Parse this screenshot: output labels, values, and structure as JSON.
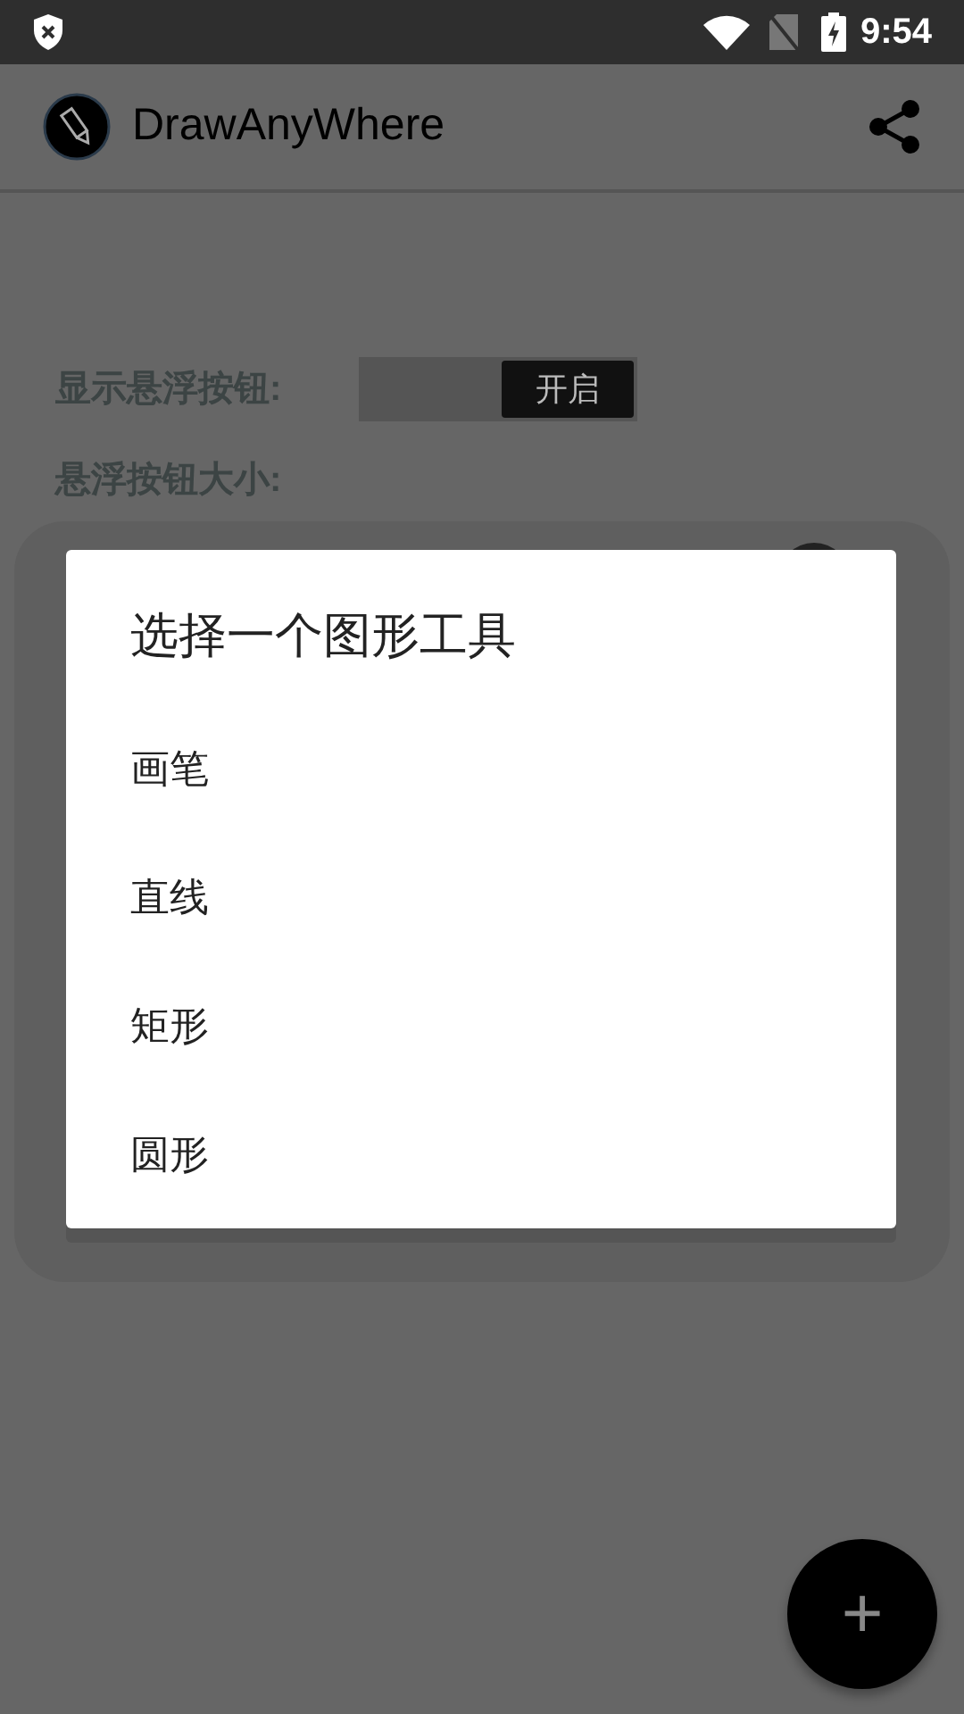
{
  "status_bar": {
    "time": "9:54"
  },
  "app_bar": {
    "title": "DrawAnyWhere"
  },
  "settings": {
    "show_button_label": "显示悬浮按钮:",
    "toggle": {
      "label": "开启",
      "on": true
    },
    "size_label": "悬浮按钮大小:"
  },
  "dialog": {
    "title": "选择一个图形工具",
    "options": [
      {
        "label": "画笔"
      },
      {
        "label": "直线"
      },
      {
        "label": "矩形"
      },
      {
        "label": "圆形"
      }
    ]
  },
  "fab": {
    "label": "+"
  }
}
